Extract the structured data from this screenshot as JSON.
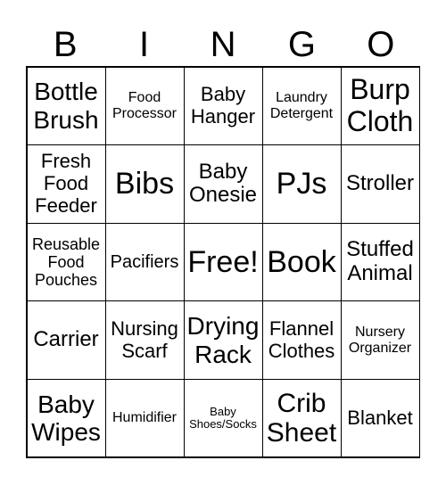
{
  "header": [
    "B",
    "I",
    "N",
    "G",
    "O"
  ],
  "cells": [
    [
      "Bottle Brush",
      "Food Processor",
      "Baby Hanger",
      "Laundry Detergent",
      "Burp Cloth"
    ],
    [
      "Fresh Food Feeder",
      "Bibs",
      "Baby Onesie",
      "PJs",
      "Stroller"
    ],
    [
      "Reusable Food Pouches",
      "Pacifiers",
      "Free!",
      "Book",
      "Stuffed Animal"
    ],
    [
      "Carrier",
      "Nursing Scarf",
      "Drying Rack",
      "Flannel Clothes",
      "Nursery Organizer"
    ],
    [
      "Baby Wipes",
      "Humidifier",
      "Baby Shoes/Socks",
      "Crib Sheet",
      "Blanket"
    ]
  ]
}
